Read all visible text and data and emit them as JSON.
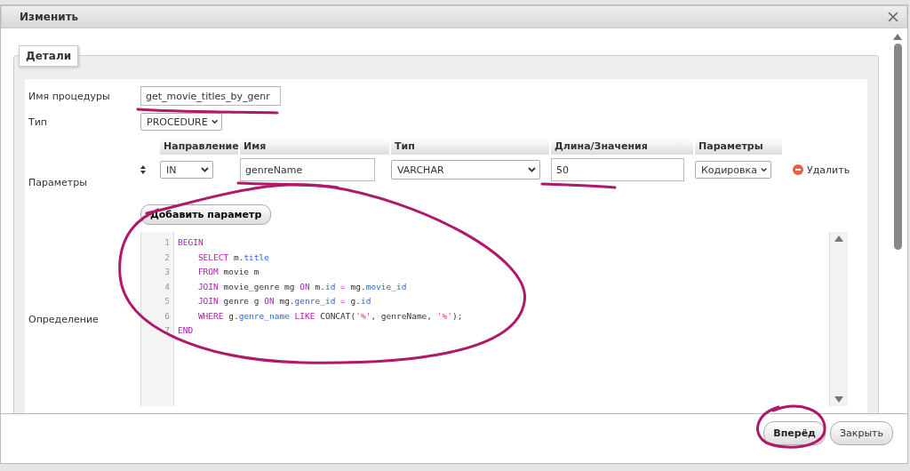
{
  "dialog": {
    "title": "Изменить"
  },
  "fieldset": {
    "legend": "Детали"
  },
  "name_field": {
    "label": "Имя процедуры",
    "value": "get_movie_titles_by_genr"
  },
  "type_field": {
    "label": "Тип",
    "value": "PROCEDURE"
  },
  "parameters": {
    "label": "Параметры",
    "columns": [
      "Направление",
      "Имя",
      "Тип",
      "Длина/Значения",
      "Параметры"
    ],
    "rows": [
      {
        "direction": "IN",
        "name": "genreName",
        "type": "VARCHAR",
        "length": "50",
        "options": "Кодировка",
        "delete": "Удалить"
      }
    ],
    "add_button": "Добавить параметр"
  },
  "definition": {
    "label": "Определение",
    "lines": [
      {
        "number": "1",
        "tokens": [
          {
            "kind": "keyword",
            "text": "BEGIN"
          }
        ]
      },
      {
        "number": "2",
        "indent": true,
        "tokens": [
          {
            "kind": "keyword",
            "text": "SELECT"
          },
          {
            "kind": "plain",
            "text": " m."
          },
          {
            "kind": "field",
            "text": "title"
          }
        ]
      },
      {
        "number": "3",
        "indent": true,
        "tokens": [
          {
            "kind": "keyword",
            "text": "FROM"
          },
          {
            "kind": "plain",
            "text": " movie m"
          }
        ]
      },
      {
        "number": "4",
        "indent": true,
        "tokens": [
          {
            "kind": "keyword",
            "text": "JOIN"
          },
          {
            "kind": "plain",
            "text": " movie_genre mg "
          },
          {
            "kind": "keyword",
            "text": "ON"
          },
          {
            "kind": "plain",
            "text": " m."
          },
          {
            "kind": "field",
            "text": "id"
          },
          {
            "kind": "op",
            "text": " = "
          },
          {
            "kind": "plain",
            "text": "mg."
          },
          {
            "kind": "field",
            "text": "movie_id"
          }
        ]
      },
      {
        "number": "5",
        "indent": true,
        "tokens": [
          {
            "kind": "keyword",
            "text": "JOIN"
          },
          {
            "kind": "plain",
            "text": " genre g "
          },
          {
            "kind": "keyword",
            "text": "ON"
          },
          {
            "kind": "plain",
            "text": " mg."
          },
          {
            "kind": "field",
            "text": "genre_id"
          },
          {
            "kind": "op",
            "text": " = "
          },
          {
            "kind": "plain",
            "text": "g."
          },
          {
            "kind": "field",
            "text": "id"
          }
        ]
      },
      {
        "number": "6",
        "indent": true,
        "tokens": [
          {
            "kind": "keyword",
            "text": "WHERE"
          },
          {
            "kind": "plain",
            "text": " g."
          },
          {
            "kind": "field",
            "text": "genre_name"
          },
          {
            "kind": "keyword",
            "text": " LIKE"
          },
          {
            "kind": "plain",
            "text": " CONCAT("
          },
          {
            "kind": "string",
            "text": "'%'"
          },
          {
            "kind": "plain",
            "text": ", genreName, "
          },
          {
            "kind": "string",
            "text": "'%'"
          },
          {
            "kind": "plain",
            "text": ");"
          }
        ]
      },
      {
        "number": "7",
        "tokens": [
          {
            "kind": "keyword",
            "text": "END"
          }
        ]
      }
    ]
  },
  "buttons": [
    {
      "label": "Вперёд",
      "primary": true
    },
    {
      "label": "Закрыть",
      "primary": false
    }
  ]
}
